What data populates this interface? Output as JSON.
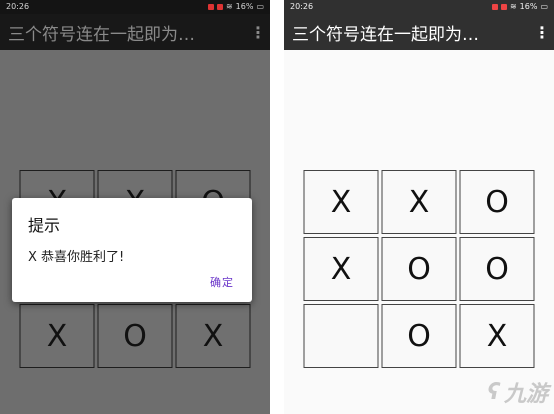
{
  "status_bar": {
    "time": "20:26",
    "battery": "16%"
  },
  "app": {
    "title": "三个符号连在一起即为…",
    "menu_icon": "more-vert-icon"
  },
  "left_board": [
    [
      "X",
      "X",
      "O"
    ],
    [
      "",
      "",
      ""
    ],
    [
      "X",
      "O",
      "X"
    ]
  ],
  "right_board": [
    [
      "X",
      "X",
      "O"
    ],
    [
      "X",
      "O",
      "O"
    ],
    [
      "",
      "O",
      "X"
    ]
  ],
  "dialog": {
    "title": "提示",
    "message": "X 恭喜你胜利了!",
    "button": "确定"
  },
  "watermark": {
    "text": "九游"
  }
}
